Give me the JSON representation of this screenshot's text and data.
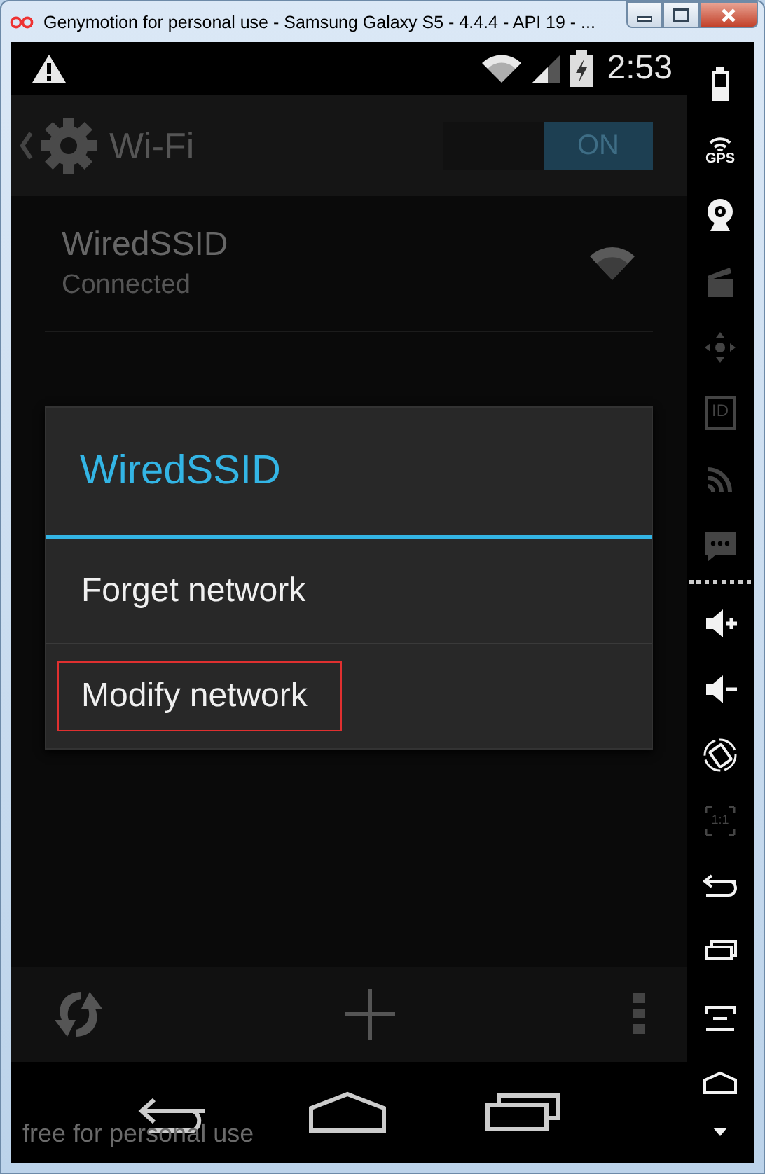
{
  "window": {
    "title": "Genymotion for personal use - Samsung Galaxy S5 - 4.4.4 - API 19 - ..."
  },
  "status_bar": {
    "time": "2:53"
  },
  "action_bar": {
    "title": "Wi-Fi",
    "switch": {
      "label": "ON",
      "on": true
    }
  },
  "networks": [
    {
      "name": "WiredSSID",
      "status": "Connected"
    }
  ],
  "dialog": {
    "title": "WiredSSID",
    "items": [
      {
        "label": "Forget network",
        "highlighted": false
      },
      {
        "label": "Modify network",
        "highlighted": true
      }
    ]
  },
  "overlay_text": "free for personal use",
  "sidebar": {
    "tools": [
      {
        "kind": "battery",
        "disabled": false
      },
      {
        "kind": "gps",
        "label": "GPS",
        "disabled": false
      },
      {
        "kind": "webcam",
        "disabled": false
      },
      {
        "kind": "clapper",
        "disabled": true
      },
      {
        "kind": "dpad",
        "disabled": true
      },
      {
        "kind": "id",
        "label": "ID",
        "disabled": true
      },
      {
        "kind": "rss",
        "disabled": true
      },
      {
        "kind": "sms",
        "disabled": true
      }
    ],
    "controls": [
      {
        "kind": "volume_up",
        "disabled": false
      },
      {
        "kind": "volume_down",
        "disabled": false
      },
      {
        "kind": "rotate",
        "disabled": false
      },
      {
        "kind": "scale",
        "label": "1:1",
        "disabled": true
      },
      {
        "kind": "back",
        "disabled": false
      },
      {
        "kind": "recents",
        "disabled": false
      },
      {
        "kind": "menu",
        "disabled": false
      },
      {
        "kind": "home",
        "disabled": false
      },
      {
        "kind": "more",
        "disabled": false
      }
    ]
  }
}
